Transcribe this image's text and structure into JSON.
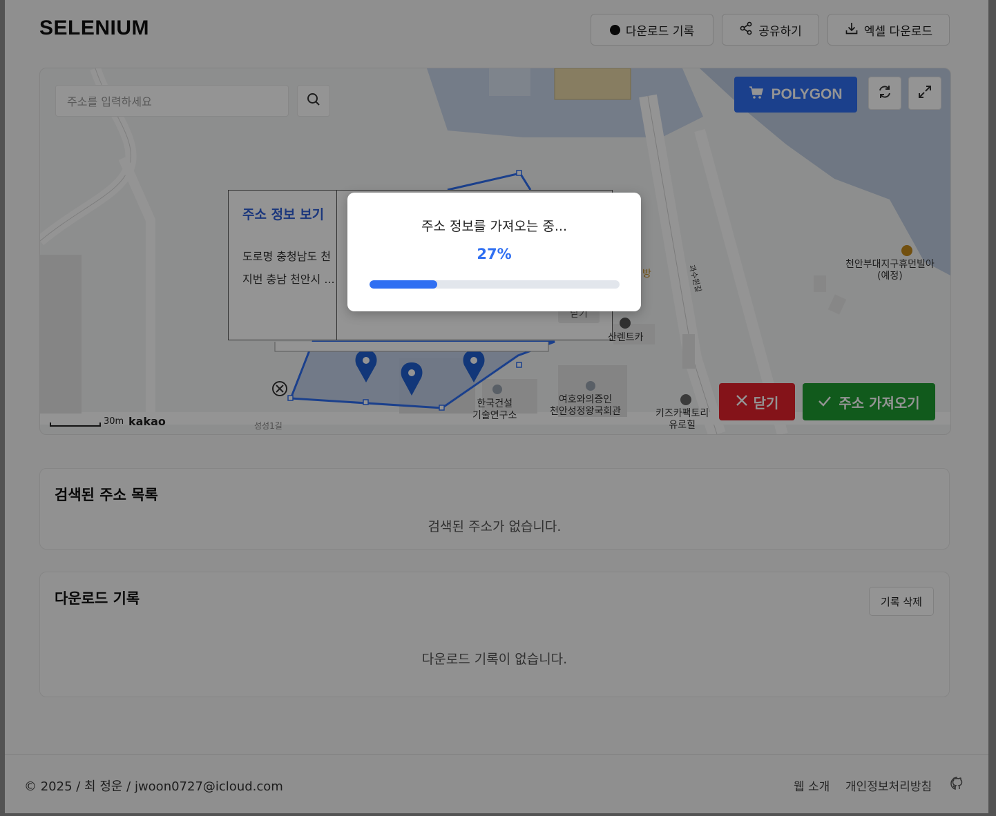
{
  "header": {
    "brand": "SELENIUM",
    "download_history_label": "다운로드 기록",
    "share_label": "공유하기",
    "excel_download_label": "엑셀 다운로드"
  },
  "map": {
    "search_placeholder": "주소를 입력하세요",
    "polygon_label": "POLYGON",
    "info_panel": {
      "title": "주소 정보 보기",
      "road_label": "도로명",
      "road_value": "충청남도 천",
      "lot_label": "지번",
      "lot_value": "충남 천안시 ...",
      "close_label": "닫기"
    },
    "place_labels": {
      "korea_construction": [
        "한국건설",
        "기술연구소"
      ],
      "veterans": [
        "여호와의증인",
        "천안성정왕국회관"
      ],
      "kids_cafe": [
        "키즈카팩토리",
        "유로힐"
      ],
      "apartment": [
        "천안부대지구휴먼빌아",
        "(예정)"
      ],
      "rentcar": "산렌트카",
      "road_a": "과수원길",
      "road_b": "성성1길",
      "fragment": "방"
    },
    "scale_label": "30m",
    "provider": "kakao",
    "close_button": "닫기",
    "fetch_button": "주소 가져오기",
    "colors": {
      "primary": "#2f6ff2",
      "danger": "#e3212b",
      "success": "#1e9c31"
    }
  },
  "address_list": {
    "title": "검색된 주소 목록",
    "empty": "검색된 주소가 없습니다."
  },
  "download_history": {
    "title": "다운로드 기록",
    "delete_label": "기록 삭제",
    "empty": "다운로드 기록이 없습니다."
  },
  "footer": {
    "copyright": "© 2025 / 최 정운 / jwoon0727@icloud.com",
    "about_label": "웹 소개",
    "privacy_label": "개인정보처리방침"
  },
  "loading_modal": {
    "message": "주소 정보를 가져오는 중...",
    "percent_label": "27%",
    "progress": 0.27
  }
}
